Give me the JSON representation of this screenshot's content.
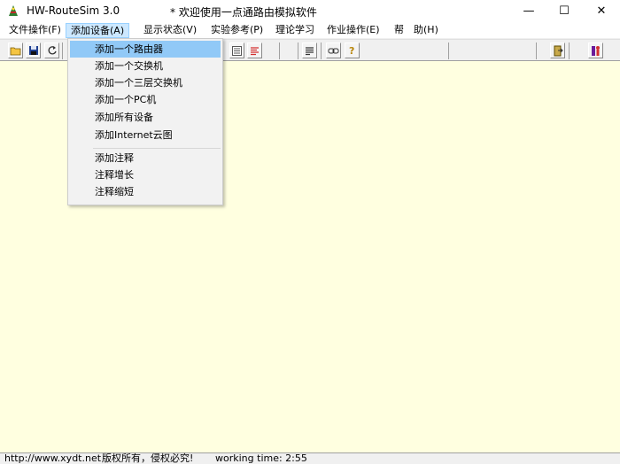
{
  "window": {
    "app_title": "HW-RouteSim 3.0",
    "welcome": "* 欢迎使用一点通路由模拟软件",
    "min_glyph": "—",
    "max_glyph": "☐",
    "close_glyph": "✕"
  },
  "menubar": {
    "items": [
      {
        "label": "文件操作(F)"
      },
      {
        "label": "添加设备(A)"
      },
      {
        "label": "显示状态(V)"
      },
      {
        "label": "实验参考(P)"
      },
      {
        "label": "理论学习"
      },
      {
        "label": "作业操作(E)"
      },
      {
        "label": "帮　助(H)"
      }
    ]
  },
  "dropdown": {
    "items": [
      {
        "label": "添加一个路由器"
      },
      {
        "label": "添加一个交换机"
      },
      {
        "label": "添加一个三层交换机"
      },
      {
        "label": "添加一个PC机"
      },
      {
        "label": "添加所有设备"
      },
      {
        "label": "添加Internet云图"
      },
      {
        "label": "添加注释"
      },
      {
        "label": "注释增长"
      },
      {
        "label": "注释缩短"
      }
    ]
  },
  "statusbar": {
    "url": "http://www.xydt.net",
    "copyright": "版权所有，侵权必究!",
    "working_time": "working time: 2:55"
  },
  "colors": {
    "canvas": "#ffffe0",
    "menu_active": "#cce8ff",
    "dropdown_highlight": "#91c9f7"
  }
}
